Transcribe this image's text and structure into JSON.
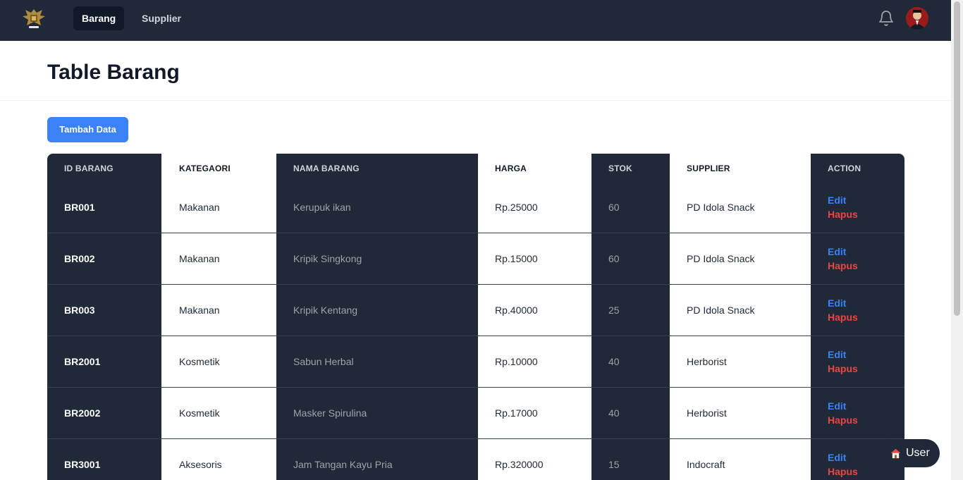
{
  "nav": {
    "links": [
      "Barang",
      "Supplier"
    ],
    "active": "Barang",
    "icons": {
      "logo": "garuda-emblem-icon",
      "notification": "bell-icon",
      "avatar": "user-avatar"
    }
  },
  "page": {
    "title": "Table Barang"
  },
  "actions": {
    "add_label": "Tambah Data",
    "edit_label": "Edit",
    "delete_label": "Hapus"
  },
  "table": {
    "headers": [
      "ID BARANG",
      "KATEGAORI",
      "NAMA BARANG",
      "HARGA",
      "STOK",
      "SUPPLIER",
      "ACTION"
    ],
    "rows": [
      {
        "id": "BR001",
        "kategori": "Makanan",
        "nama": "Kerupuk ikan",
        "harga": "Rp.25000",
        "stok": "60",
        "supplier": "PD Idola Snack"
      },
      {
        "id": "BR002",
        "kategori": "Makanan",
        "nama": "Kripik Singkong",
        "harga": "Rp.15000",
        "stok": "60",
        "supplier": "PD Idola Snack"
      },
      {
        "id": "BR003",
        "kategori": "Makanan",
        "nama": "Kripik Kentang",
        "harga": "Rp.40000",
        "stok": "25",
        "supplier": "PD Idola Snack"
      },
      {
        "id": "BR2001",
        "kategori": "Kosmetik",
        "nama": "Sabun Herbal",
        "harga": "Rp.10000",
        "stok": "40",
        "supplier": "Herborist"
      },
      {
        "id": "BR2002",
        "kategori": "Kosmetik",
        "nama": "Masker Spirulina",
        "harga": "Rp.17000",
        "stok": "40",
        "supplier": "Herborist"
      },
      {
        "id": "BR3001",
        "kategori": "Aksesoris",
        "nama": "Jam Tangan Kayu Pria",
        "harga": "Rp.320000",
        "stok": "15",
        "supplier": "Indocraft"
      }
    ]
  },
  "user_chip": {
    "label": "User",
    "icon": "house-icon"
  },
  "colors": {
    "navbar": "#1f2937",
    "accent": "#3b82f6",
    "danger": "#ef4444",
    "dark_column": "#1f2937"
  }
}
